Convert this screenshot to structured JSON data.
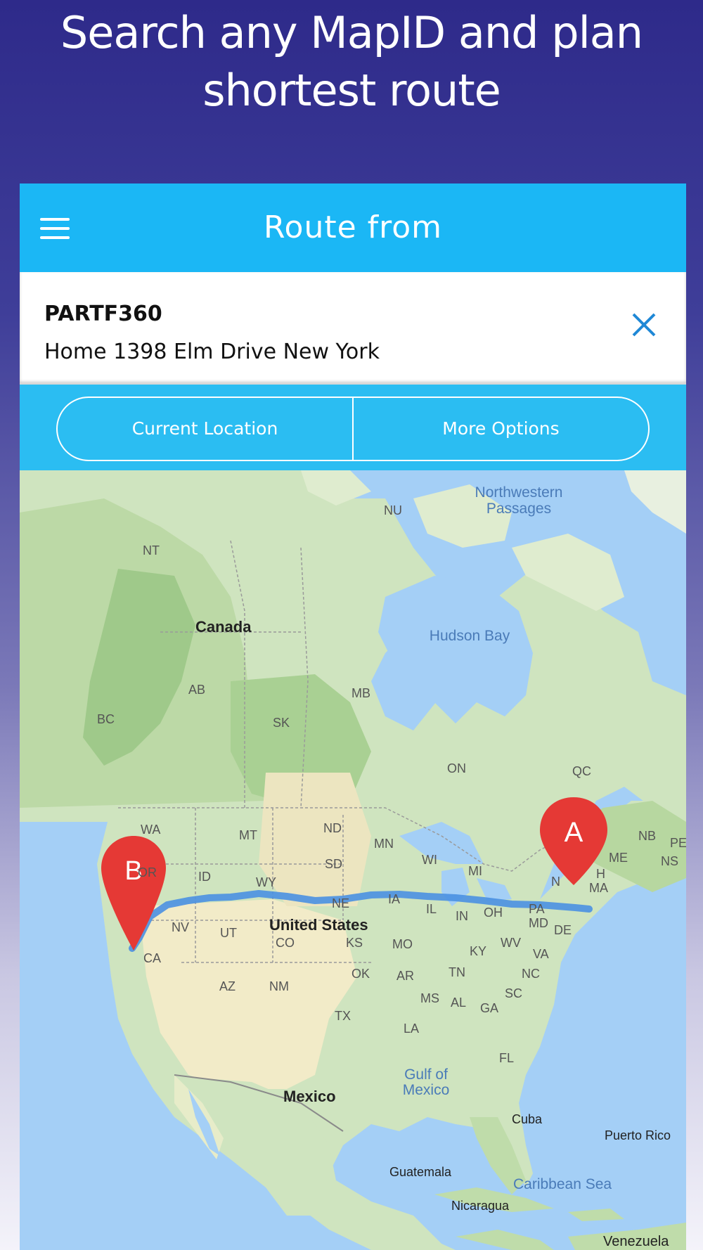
{
  "headline": {
    "line1": "Search any MapID and plan",
    "line2": "shortest route"
  },
  "appbar": {
    "title": "Route from",
    "menu_icon": "hamburger-menu-icon"
  },
  "route": {
    "code": "PARTF360",
    "address": "Home 1398 Elm Drive New York",
    "close_icon": "close-icon"
  },
  "options": {
    "current_location": "Current Location",
    "more_options": "More Options"
  },
  "map": {
    "markers": {
      "start": "A",
      "end": "B"
    },
    "labels": {
      "northwestern_1": "Northwestern",
      "northwestern_2": "Passages",
      "nu": "NU",
      "nt": "NT",
      "canada": "Canada",
      "hudson_bay": "Hudson Bay",
      "ab": "AB",
      "mb": "MB",
      "sk": "SK",
      "bc": "BC",
      "on": "ON",
      "qc": "QC",
      "wa": "WA",
      "mt": "MT",
      "nd": "ND",
      "mn": "MN",
      "nb": "NB",
      "pe": "PE",
      "ns": "NS",
      "me": "ME",
      "or": "OR",
      "id": "ID",
      "sd": "SD",
      "wi": "WI",
      "mi": "MI",
      "wy": "WY",
      "ne": "NE",
      "ia": "IA",
      "ny": "N",
      "nh": "H",
      "ma": "MA",
      "nv": "NV",
      "ut": "UT",
      "united_states": "United States",
      "il": "IL",
      "in": "IN",
      "oh": "OH",
      "pa": "PA",
      "md": "MD",
      "de": "DE",
      "ca": "CA",
      "co": "CO",
      "ks": "KS",
      "mo": "MO",
      "ky": "KY",
      "wv": "WV",
      "va": "VA",
      "az": "AZ",
      "nm": "NM",
      "ok": "OK",
      "ar": "AR",
      "tn": "TN",
      "nc": "NC",
      "tx": "TX",
      "ms": "MS",
      "al": "AL",
      "ga": "GA",
      "sc": "SC",
      "la": "LA",
      "fl": "FL",
      "gulf_1": "Gulf of",
      "gulf_2": "Mexico",
      "mexico": "Mexico",
      "cuba": "Cuba",
      "puerto_rico": "Puerto Rico",
      "guatemala": "Guatemala",
      "caribbean": "Caribbean Sea",
      "nicaragua": "Nicaragua",
      "venezuela": "Venezuela"
    }
  },
  "colors": {
    "background_top": "#2e2a8a",
    "appbar": "#1bb7f5",
    "options_bar": "#2bbdf2",
    "close_icon": "#1f88d6",
    "water": "#a4cff6",
    "route": "#4a90e2",
    "marker": "#e53935"
  }
}
